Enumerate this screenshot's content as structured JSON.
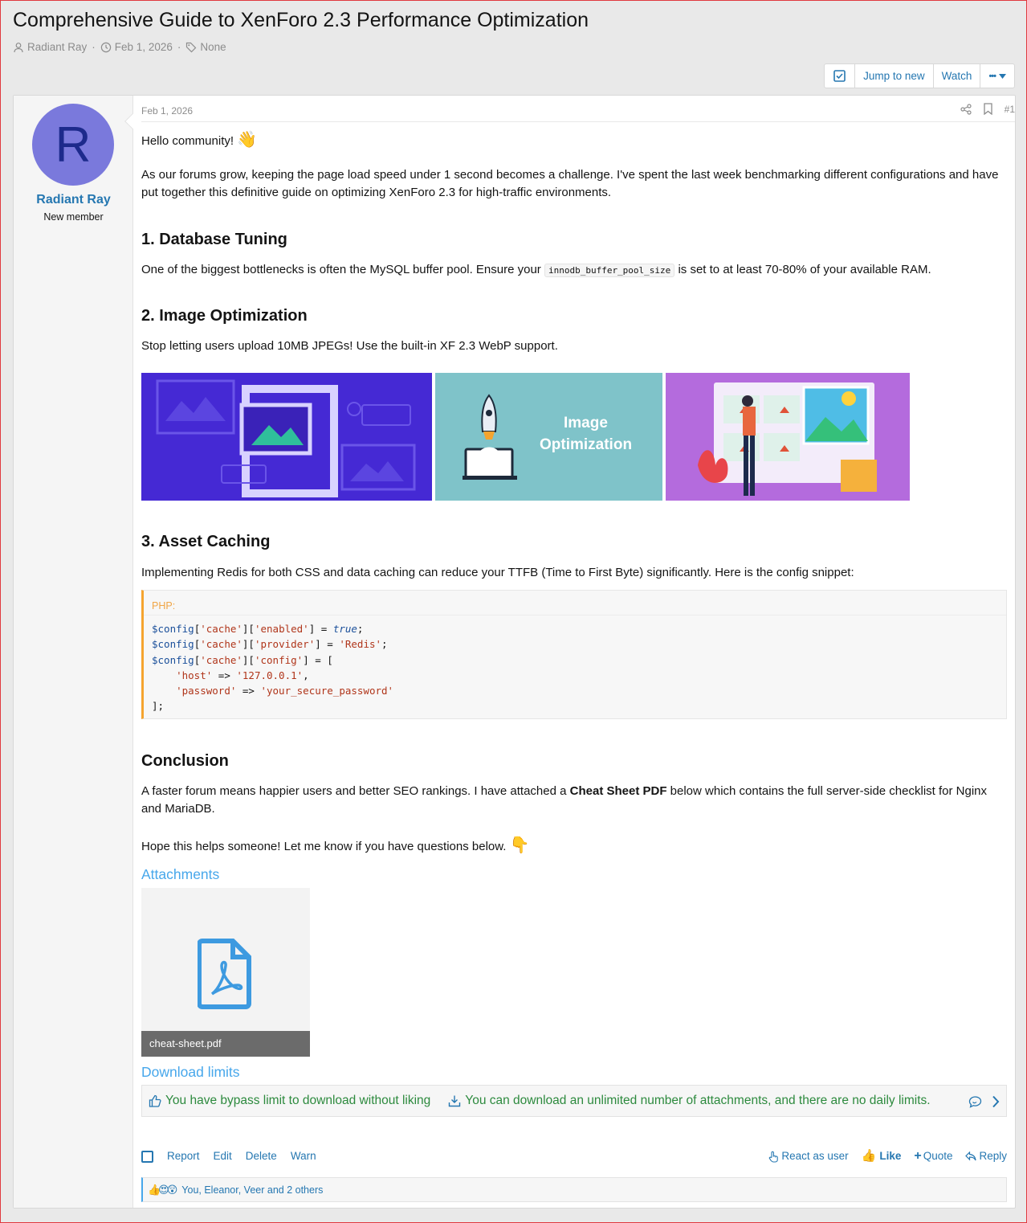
{
  "thread": {
    "title": "Comprehensive Guide to XenForo 2.3 Performance Optimization",
    "author": "Radiant Ray",
    "date": "Feb 1, 2026",
    "tags": "None",
    "sep": "·"
  },
  "toolbar": {
    "jump_label": "Jump to new",
    "watch_label": "Watch",
    "more_label": "•••"
  },
  "user": {
    "avatar_letter": "R",
    "name": "Radiant Ray",
    "title": "New member"
  },
  "post": {
    "date": "Feb 1, 2026",
    "number": "#1",
    "greeting": "Hello community!",
    "greeting_emoji": "👋",
    "intro": "As our forums grow, keeping the page load speed under 1 second becomes a challenge. I've spent the last week benchmarking different configurations and have put together this definitive guide on optimizing XenForo 2.3 for high-traffic environments.",
    "s1_title": "1. Database Tuning",
    "s1_pre": "One of the biggest bottlenecks is often the MySQL buffer pool. Ensure your ",
    "s1_code": "innodb_buffer_pool_size",
    "s1_post": " is set to at least 70-80% of your available RAM.",
    "s2_title": "2. Image Optimization",
    "s2_text": "Stop letting users upload 10MB JPEGs! Use the built-in XF 2.3 WebP support.",
    "img2_text_line1": "Image",
    "img2_text_line2": "Optimization",
    "s3_title": "3. Asset Caching",
    "s3_text": "Implementing Redis for both CSS and data caching can reduce your TTFB (Time to First Byte) significantly. Here is the config snippet:",
    "code_lang": "PHP:",
    "conclusion_title": "Conclusion",
    "conclusion_pre": "A faster forum means happier users and better SEO rankings. I have attached a ",
    "conclusion_bold": "Cheat Sheet PDF",
    "conclusion_post": " below which contains the full server-side checklist for Nginx and MariaDB.",
    "closing": "Hope this helps someone! Let me know if you have questions below.",
    "closing_emoji": "👇"
  },
  "attachments": {
    "title": "Attachments",
    "file_name": "cheat-sheet.pdf"
  },
  "download": {
    "title": "Download limits",
    "bypass": "You have bypass limit to download without liking",
    "unlimited": "You can download an unlimited number of attachments, and there are no daily limits."
  },
  "actions": {
    "report": "Report",
    "edit": "Edit",
    "delete": "Delete",
    "warn": "Warn",
    "react_as_user": "React as user",
    "like": "Like",
    "quote": "Quote",
    "reply": "Reply"
  },
  "reactions": {
    "emojis": "👍😍😲",
    "text": "You, Eleanor, Veer and 2 others"
  },
  "colors": {
    "link": "#2577b1",
    "accent_light": "#47a7eb",
    "avatar_bg": "#7a79dc",
    "code_border": "#f5a42f",
    "download_green": "#2d8a3e"
  }
}
